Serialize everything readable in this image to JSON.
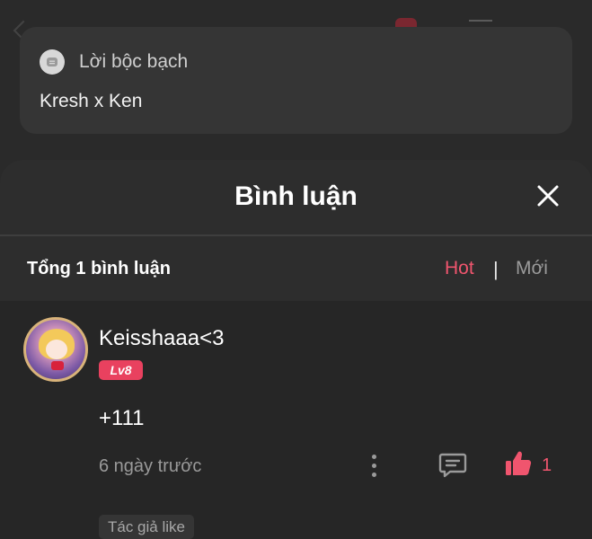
{
  "confession": {
    "label": "Lời bộc bạch",
    "text": "Kresh x Ken"
  },
  "comments_sheet": {
    "title": "Bình luận",
    "total_label": "Tổng 1 bình luận",
    "sort": {
      "hot": "Hot",
      "separator": "|",
      "new": "Mới",
      "active": "Hot"
    }
  },
  "comments": [
    {
      "username": "Keisshaaa<3",
      "level": "Lv8",
      "text": "+111",
      "time": "6 ngày trước",
      "likes": "1",
      "author_like": "Tác giả like"
    }
  ],
  "colors": {
    "accent": "#f0556e",
    "level_badge": "#e9415f",
    "sheet_bg": "#2d2d2d",
    "comment_bg": "#262626"
  },
  "icons": [
    "message-icon",
    "close-icon",
    "more-icon",
    "reply-icon",
    "thumbs-up-icon"
  ]
}
